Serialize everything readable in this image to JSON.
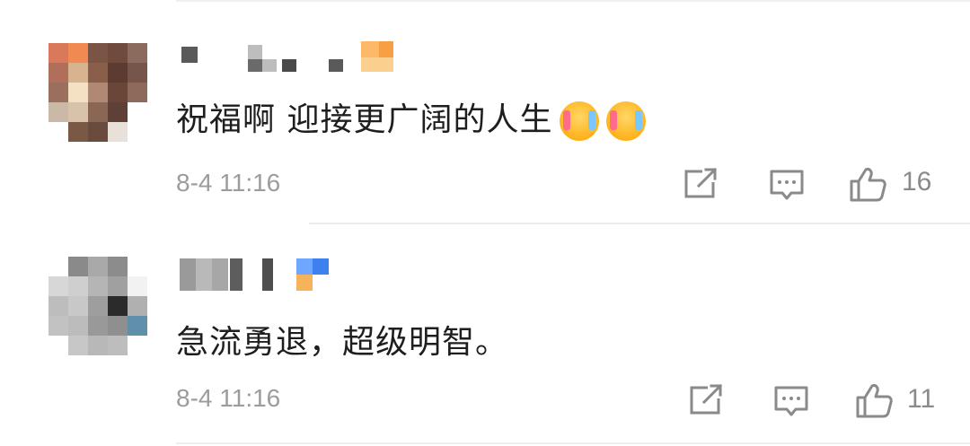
{
  "comments": [
    {
      "text": "祝福啊 迎接更广阔的人生",
      "emojis": [
        "laughing-crying-face",
        "laughing-crying-face"
      ],
      "time": "8-4 11:16",
      "likes": "16"
    },
    {
      "text": "急流勇退，超级明智。",
      "emojis": [],
      "time": "8-4 11:16",
      "likes": "11"
    }
  ],
  "icons": {
    "share": "share-icon",
    "reply": "comment-icon",
    "like": "thumbs-up-icon"
  },
  "colors": {
    "text": "#1e1e1e",
    "meta": "#9c9c9c",
    "icon": "#8a8a8a",
    "divider": "#ececec"
  }
}
